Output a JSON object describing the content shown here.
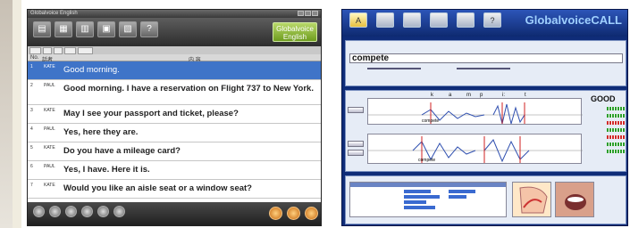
{
  "left_app": {
    "title": "Globalvoice English",
    "logo": "Globalvoice English",
    "tools": [
      "icon-a",
      "icon-b",
      "icon-c",
      "icon-d",
      "icon-e",
      "?"
    ],
    "columns": [
      "No.",
      "話者",
      "内 容"
    ],
    "rows": [
      {
        "num": "1",
        "speaker": "KATE",
        "text": "Good morning."
      },
      {
        "num": "2",
        "speaker": "PAUL",
        "text": "Good morning. I have a reservation on Flight 737 to New York."
      },
      {
        "num": "3",
        "speaker": "KATE",
        "text": "May I see your passport and ticket, please?"
      },
      {
        "num": "4",
        "speaker": "PAUL",
        "text": "Yes, here they are."
      },
      {
        "num": "5",
        "speaker": "KATE",
        "text": "Do you have a mileage card?"
      },
      {
        "num": "6",
        "speaker": "PAUL",
        "text": "Yes, I have. Here it is."
      },
      {
        "num": "7",
        "speaker": "KATE",
        "text": "Would you like an aisle seat or a window seat?"
      }
    ]
  },
  "right_app": {
    "logo": "GlobalvoiceCALL",
    "toolbar_first": "A",
    "word": "compete",
    "score": "GOOD",
    "phonemes": [
      "k",
      "a",
      "m",
      "p",
      "i:",
      "t"
    ],
    "wave_label": "compete",
    "help_tool": "?"
  }
}
